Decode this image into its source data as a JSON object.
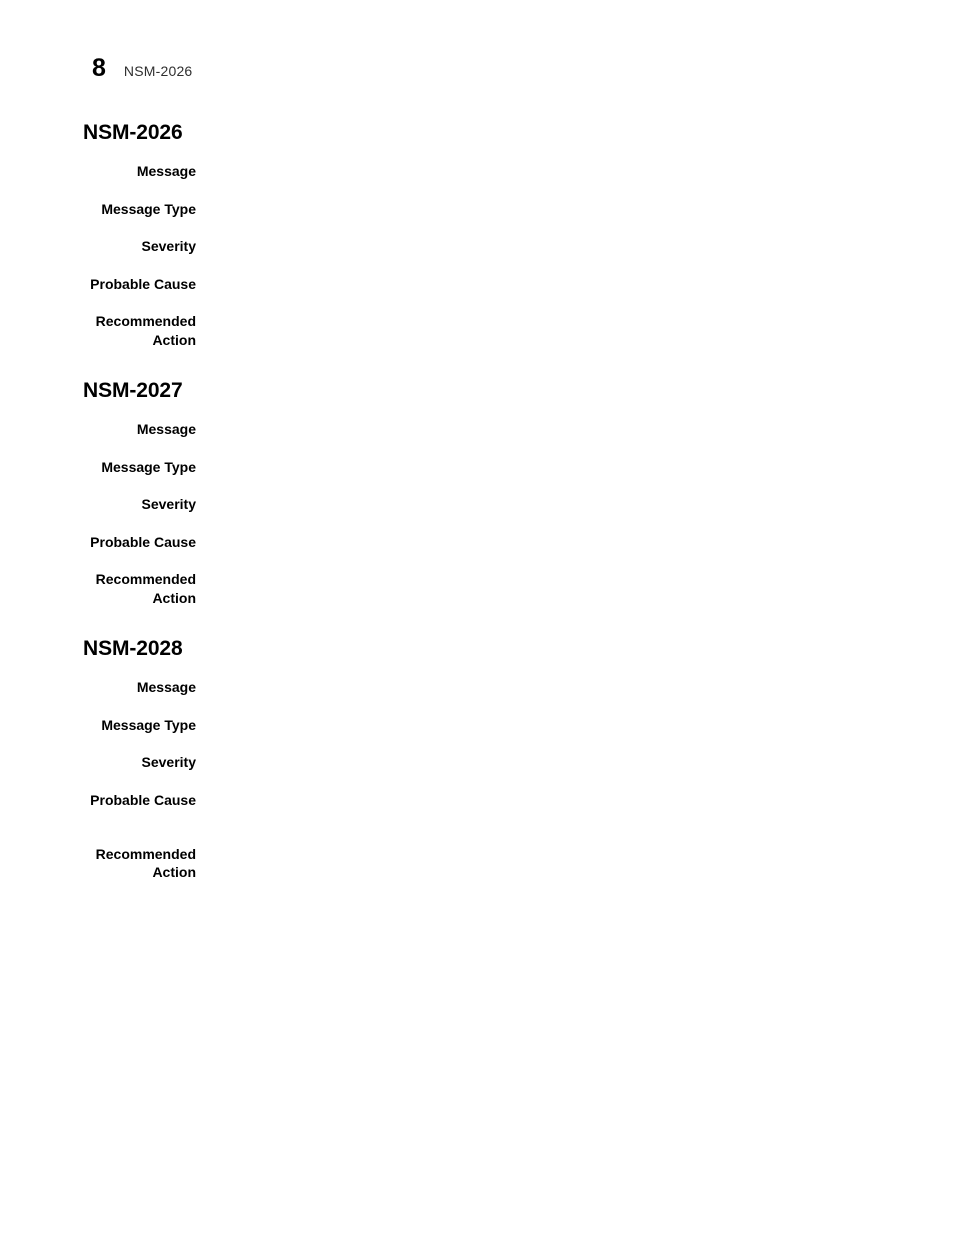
{
  "header": {
    "page_number": "8",
    "document_title": "NSM-2026"
  },
  "sections": [
    {
      "heading": "NSM-2026",
      "fields": [
        {
          "label": "Message",
          "value": ""
        },
        {
          "label": "Message Type",
          "value": ""
        },
        {
          "label": "Severity",
          "value": ""
        },
        {
          "label": "Probable Cause",
          "value": ""
        },
        {
          "label": "Recommended\nAction",
          "value": ""
        }
      ]
    },
    {
      "heading": "NSM-2027",
      "fields": [
        {
          "label": "Message",
          "value": ""
        },
        {
          "label": "Message Type",
          "value": ""
        },
        {
          "label": "Severity",
          "value": ""
        },
        {
          "label": "Probable Cause",
          "value": ""
        },
        {
          "label": "Recommended\nAction",
          "value": ""
        }
      ]
    },
    {
      "heading": "NSM-2028",
      "fields": [
        {
          "label": "Message",
          "value": ""
        },
        {
          "label": "Message Type",
          "value": ""
        },
        {
          "label": "Severity",
          "value": ""
        },
        {
          "label": "Probable Cause",
          "value": ""
        },
        {
          "label": "Recommended\nAction",
          "value": "",
          "extra_gap": true
        }
      ]
    }
  ],
  "colors": {
    "page_background": "#ffffff",
    "body_text": "#000000",
    "header_title_text": "#2f2f2f"
  }
}
